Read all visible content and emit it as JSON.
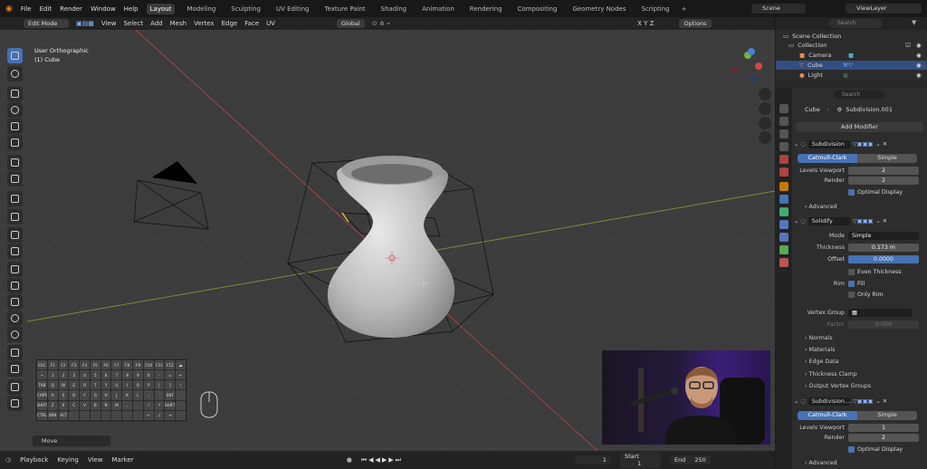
{
  "menu": {
    "items": [
      "File",
      "Edit",
      "Render",
      "Window",
      "Help"
    ]
  },
  "workspaces": {
    "active": "Layout",
    "tabs": [
      "Layout",
      "Modeling",
      "Sculpting",
      "UV Editing",
      "Texture Paint",
      "Shading",
      "Animation",
      "Rendering",
      "Compositing",
      "Geometry Nodes",
      "Scripting"
    ]
  },
  "scene": {
    "name": "Scene",
    "view_layer": "ViewLayer"
  },
  "viewport_header": {
    "mode": "Edit Mode",
    "menus": [
      "View",
      "Select",
      "Add",
      "Mesh",
      "Vertex",
      "Edge",
      "Face",
      "UV"
    ],
    "transform": "Global",
    "axes": "X Y Z",
    "options": "Options"
  },
  "viewport": {
    "view_name": "User Orthographic",
    "object": "(1) Cube",
    "last_op": "Move"
  },
  "keyboard": {
    "keys": [
      "ESC",
      "F1",
      "F2",
      "F3",
      "F4",
      "F5",
      "F6",
      "F7",
      "F8",
      "F9",
      "F10",
      "F11",
      "F12",
      "⏏",
      "~",
      "1",
      "2",
      "3",
      "4",
      "5",
      "6",
      "7",
      "8",
      "9",
      "0",
      "-",
      "=",
      "←",
      "TAB",
      "Q",
      "W",
      "E",
      "R",
      "T",
      "Y",
      "U",
      "I",
      "O",
      "P",
      "[",
      "]",
      "\\",
      "CAPS",
      "A",
      "S",
      "D",
      "F",
      "G",
      "H",
      "J",
      "K",
      "L",
      ";",
      "'",
      "ENT",
      "",
      "SHIFT",
      "Z",
      "X",
      "C",
      "V",
      "B",
      "N",
      "M",
      ",",
      ".",
      "/",
      "↑",
      "SHIFT",
      "",
      "CTRL",
      "WIN",
      "ALT",
      "",
      "",
      "",
      "",
      "",
      "",
      "",
      "←",
      "↓",
      "→",
      ""
    ]
  },
  "timeline": {
    "menus": [
      "Playback",
      "Keying",
      "View",
      "Marker"
    ],
    "current_frame": "1",
    "start_label": "Start",
    "start": "1",
    "end_label": "End",
    "end": "250"
  },
  "outliner": {
    "search_placeholder": "Search",
    "root": "Scene Collection",
    "collection": "Collection",
    "items": [
      "Camera",
      "Cube",
      "Light"
    ]
  },
  "properties": {
    "search_placeholder": "Search",
    "breadcrumb_object": "Cube",
    "breadcrumb_modifier": "Subdivision.001",
    "add_modifier": "Add Modifier",
    "subdivision": {
      "name": "Subdivision",
      "catmull": "Catmull-Clark",
      "simple": "Simple",
      "levels_label": "Levels Viewport",
      "levels": "2",
      "render_label": "Render",
      "render": "2",
      "optimal": "Optimal Display",
      "advanced": "Advanced"
    },
    "solidify": {
      "name": "Solidify",
      "mode_label": "Mode",
      "mode": "Simple",
      "thickness_label": "Thickness",
      "thickness": "0.173 m",
      "offset_label": "Offset",
      "offset": "0.0000",
      "even": "Even Thickness",
      "rim_label": "Rim",
      "fill": "Fill",
      "only_rim": "Only Rim",
      "vgroup_label": "Vertex Group",
      "factor_label": "Factor",
      "factor": "0.000",
      "sections": [
        "Normals",
        "Materials",
        "Edge Data",
        "Thickness Clamp",
        "Output Vertex Groups"
      ]
    },
    "subdivision2": {
      "name": "Subdivision....",
      "catmull": "Catmull-Clark",
      "simple": "Simple",
      "levels_label": "Levels Viewport",
      "levels": "1",
      "render_label": "Render",
      "render": "2",
      "optimal": "Optimal Display",
      "advanced": "Advanced"
    }
  },
  "colors": {
    "accent": "#4772b3",
    "x_axis": "#b84a4a",
    "y_axis": "#8aa23a"
  }
}
